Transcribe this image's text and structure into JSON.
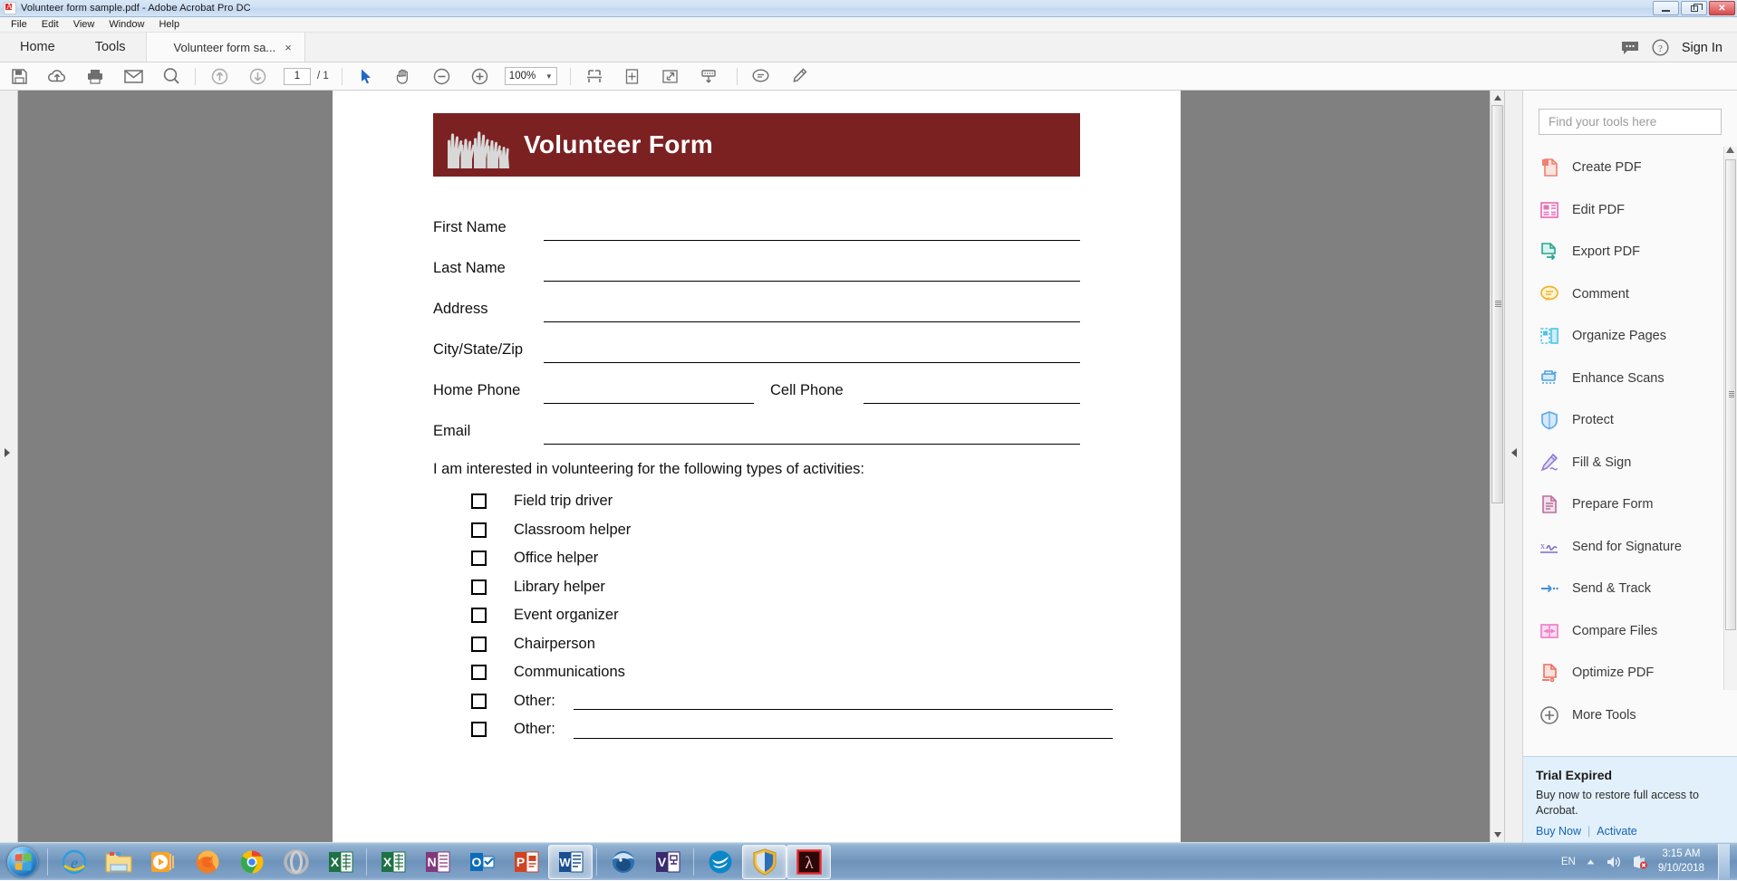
{
  "window": {
    "title": "Volunteer form sample.pdf - Adobe Acrobat Pro DC",
    "app_icon": "acrobat-icon",
    "controls": {
      "minimize": "minimize",
      "restore": "restore",
      "close": "close"
    }
  },
  "menubar": {
    "items": [
      "File",
      "Edit",
      "View",
      "Window",
      "Help"
    ]
  },
  "tabbar": {
    "home_label": "Home",
    "tools_label": "Tools",
    "document_tab_label": "Volunteer form sa...",
    "document_tab_close": "×",
    "comment_icon": "speech-bubble-icon",
    "help_icon": "question-mark-icon",
    "signin_label": "Sign In"
  },
  "toolbar": {
    "icons": [
      "save-icon",
      "upload-to-cloud-icon",
      "print-icon",
      "email-icon",
      "search-icon",
      "previous-page-icon",
      "next-page-icon"
    ],
    "page_number": "1",
    "page_count": "/ 1",
    "tools": [
      "select-tool-icon",
      "hand-tool-icon",
      "zoom-out-icon",
      "zoom-in-icon"
    ],
    "zoom_level": "100%",
    "zoom_caret": "▼",
    "view_icons": [
      "fit-page-width-icon",
      "fit-page-icon",
      "fullscreen-icon",
      "scroll-mode-icon"
    ],
    "annotation_icons": [
      "add-comment-icon",
      "highlight-text-icon"
    ]
  },
  "document": {
    "banner": {
      "title": "Volunteer Form",
      "background_color": "#7B2122",
      "graphic": "raised-hands-icon"
    },
    "fields": [
      {
        "label": "First Name"
      },
      {
        "label": "Last Name"
      },
      {
        "label": "Address"
      },
      {
        "label": "City/State/Zip"
      }
    ],
    "phone_row": {
      "home_label": "Home Phone",
      "cell_label": "Cell Phone"
    },
    "email_field": {
      "label": "Email"
    },
    "prompt": "I am interested in volunteering for the following types of activities:",
    "checkboxes": [
      {
        "label": "Field trip driver",
        "has_line": false,
        "checked": false
      },
      {
        "label": "Classroom helper",
        "has_line": false,
        "checked": false
      },
      {
        "label": "Office helper",
        "has_line": false,
        "checked": false
      },
      {
        "label": "Library helper",
        "has_line": false,
        "checked": false
      },
      {
        "label": "Event organizer",
        "has_line": false,
        "checked": false
      },
      {
        "label": "Chairperson",
        "has_line": false,
        "checked": false
      },
      {
        "label": "Communications",
        "has_line": false,
        "checked": false
      },
      {
        "label": "Other:",
        "has_line": true,
        "checked": false
      },
      {
        "label": "Other:",
        "has_line": true,
        "checked": false
      }
    ]
  },
  "tools_panel": {
    "search_placeholder": "Find your tools here",
    "items": [
      {
        "label": "Create PDF",
        "icon": "create-pdf-icon",
        "color": "#F08070"
      },
      {
        "label": "Edit PDF",
        "icon": "edit-pdf-icon",
        "color": "#E86FB8"
      },
      {
        "label": "Export PDF",
        "icon": "export-pdf-icon",
        "color": "#27A592"
      },
      {
        "label": "Comment",
        "icon": "comment-icon",
        "color": "#F0B429"
      },
      {
        "label": "Organize Pages",
        "icon": "organize-pages-icon",
        "color": "#4FC3E8"
      },
      {
        "label": "Enhance Scans",
        "icon": "enhance-scans-icon",
        "color": "#4A9FE0"
      },
      {
        "label": "Protect",
        "icon": "protect-shield-icon",
        "color": "#5FA8E8"
      },
      {
        "label": "Fill & Sign",
        "icon": "fill-and-sign-icon",
        "color": "#8E7BD8"
      },
      {
        "label": "Prepare Form",
        "icon": "prepare-form-icon",
        "color": "#BE6C9E"
      },
      {
        "label": "Send for Signature",
        "icon": "send-for-signature-icon",
        "color": "#7B6BD0"
      },
      {
        "label": "Send & Track",
        "icon": "send-and-track-icon",
        "color": "#3D8FD8"
      },
      {
        "label": "Compare Files",
        "icon": "compare-files-icon",
        "color": "#EE7BC8"
      },
      {
        "label": "Optimize PDF",
        "icon": "optimize-pdf-icon",
        "color": "#EE6E5E"
      },
      {
        "label": "More Tools",
        "icon": "more-tools-plus-icon",
        "color": "#6E6E6E"
      }
    ]
  },
  "trial": {
    "title": "Trial Expired",
    "message": "Buy now to restore full access to Acrobat.",
    "buy_label": "Buy Now",
    "separator": "|",
    "activate_label": "Activate"
  },
  "taskbar": {
    "start_label": "start-orb",
    "pinned": [
      {
        "name": "internet-explorer-icon",
        "active": false
      },
      {
        "name": "file-explorer-icon",
        "active": false
      },
      {
        "name": "windows-media-player-icon",
        "active": false
      },
      {
        "name": "firefox-icon",
        "active": false
      },
      {
        "name": "chrome-icon",
        "active": false
      },
      {
        "name": "opera-icon",
        "active": false
      },
      {
        "name": "excel-icon",
        "active": false
      },
      {
        "name": "excel-icon-2",
        "active": false
      },
      {
        "name": "onenote-icon",
        "active": false
      },
      {
        "name": "outlook-icon",
        "active": false
      },
      {
        "name": "powerpoint-icon",
        "active": false
      },
      {
        "name": "word-icon",
        "active": true
      },
      {
        "name": "thunderbird-icon",
        "active": false
      },
      {
        "name": "visio-icon",
        "active": false
      },
      {
        "name": "openoffice-icon",
        "active": false
      },
      {
        "name": "windows-defender-icon",
        "active": true
      },
      {
        "name": "acrobat-icon",
        "active": true
      }
    ],
    "tray": {
      "language": "EN",
      "show_hidden_icon": "chevron-up-icon",
      "volume_icon": "speaker-icon",
      "network_icon": "network-error-icon",
      "time": "3:15 AM",
      "date": "9/10/2018"
    }
  }
}
